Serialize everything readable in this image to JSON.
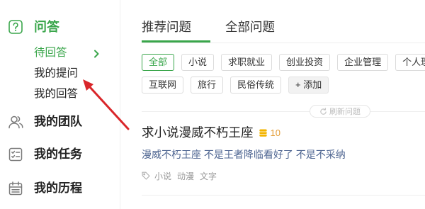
{
  "theme": {
    "accent": "#3aa64b",
    "coin": "#f3b400",
    "reward_text": "#e39b33",
    "annotation_arrow": "#d9262a"
  },
  "sidebar": {
    "qa": {
      "label": "问答",
      "icon": "question-icon",
      "active": true
    },
    "qa_items": [
      {
        "label": "待回答",
        "active": true,
        "icon": "chevron-right-icon"
      },
      {
        "label": "我的提问"
      },
      {
        "label": "我的回答"
      }
    ],
    "sections": [
      {
        "label": "我的团队",
        "icon": "team-icon"
      },
      {
        "label": "我的任务",
        "icon": "task-list-icon"
      },
      {
        "label": "我的历程",
        "icon": "calendar-icon"
      }
    ]
  },
  "main": {
    "tabs": [
      {
        "label": "推荐问题",
        "active": true
      },
      {
        "label": "全部问题"
      }
    ],
    "tag_rows": [
      [
        {
          "label": "全部",
          "active": true
        },
        {
          "label": "小说"
        },
        {
          "label": "求职就业"
        },
        {
          "label": "创业投资"
        },
        {
          "label": "企业管理"
        },
        {
          "label": "个人理"
        }
      ],
      [
        {
          "label": "互联网"
        },
        {
          "label": "旅行"
        },
        {
          "label": "民俗传统"
        },
        {
          "label": "+ 添加"
        }
      ]
    ],
    "refresh": {
      "label": "刷新问题",
      "icon": "refresh-icon"
    },
    "questions": [
      {
        "title": "求小说漫威不朽王座",
        "reward_icon": "coin-icon",
        "reward": "10",
        "description": "漫威不朽王座 不是王者降临看好了 不是不采纳",
        "tag_icon": "tag-icon",
        "tags": [
          "小说",
          "动漫",
          "文字"
        ]
      }
    ]
  }
}
